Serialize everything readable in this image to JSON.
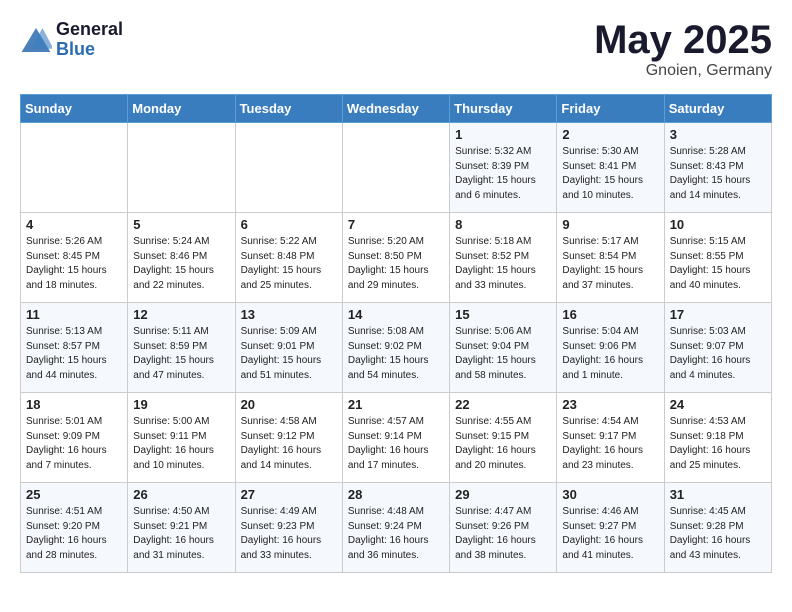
{
  "logo": {
    "general": "General",
    "blue": "Blue"
  },
  "title": "May 2025",
  "location": "Gnoien, Germany",
  "weekdays": [
    "Sunday",
    "Monday",
    "Tuesday",
    "Wednesday",
    "Thursday",
    "Friday",
    "Saturday"
  ],
  "weeks": [
    [
      {
        "num": "",
        "info": ""
      },
      {
        "num": "",
        "info": ""
      },
      {
        "num": "",
        "info": ""
      },
      {
        "num": "",
        "info": ""
      },
      {
        "num": "1",
        "info": "Sunrise: 5:32 AM\nSunset: 8:39 PM\nDaylight: 15 hours\nand 6 minutes."
      },
      {
        "num": "2",
        "info": "Sunrise: 5:30 AM\nSunset: 8:41 PM\nDaylight: 15 hours\nand 10 minutes."
      },
      {
        "num": "3",
        "info": "Sunrise: 5:28 AM\nSunset: 8:43 PM\nDaylight: 15 hours\nand 14 minutes."
      }
    ],
    [
      {
        "num": "4",
        "info": "Sunrise: 5:26 AM\nSunset: 8:45 PM\nDaylight: 15 hours\nand 18 minutes."
      },
      {
        "num": "5",
        "info": "Sunrise: 5:24 AM\nSunset: 8:46 PM\nDaylight: 15 hours\nand 22 minutes."
      },
      {
        "num": "6",
        "info": "Sunrise: 5:22 AM\nSunset: 8:48 PM\nDaylight: 15 hours\nand 25 minutes."
      },
      {
        "num": "7",
        "info": "Sunrise: 5:20 AM\nSunset: 8:50 PM\nDaylight: 15 hours\nand 29 minutes."
      },
      {
        "num": "8",
        "info": "Sunrise: 5:18 AM\nSunset: 8:52 PM\nDaylight: 15 hours\nand 33 minutes."
      },
      {
        "num": "9",
        "info": "Sunrise: 5:17 AM\nSunset: 8:54 PM\nDaylight: 15 hours\nand 37 minutes."
      },
      {
        "num": "10",
        "info": "Sunrise: 5:15 AM\nSunset: 8:55 PM\nDaylight: 15 hours\nand 40 minutes."
      }
    ],
    [
      {
        "num": "11",
        "info": "Sunrise: 5:13 AM\nSunset: 8:57 PM\nDaylight: 15 hours\nand 44 minutes."
      },
      {
        "num": "12",
        "info": "Sunrise: 5:11 AM\nSunset: 8:59 PM\nDaylight: 15 hours\nand 47 minutes."
      },
      {
        "num": "13",
        "info": "Sunrise: 5:09 AM\nSunset: 9:01 PM\nDaylight: 15 hours\nand 51 minutes."
      },
      {
        "num": "14",
        "info": "Sunrise: 5:08 AM\nSunset: 9:02 PM\nDaylight: 15 hours\nand 54 minutes."
      },
      {
        "num": "15",
        "info": "Sunrise: 5:06 AM\nSunset: 9:04 PM\nDaylight: 15 hours\nand 58 minutes."
      },
      {
        "num": "16",
        "info": "Sunrise: 5:04 AM\nSunset: 9:06 PM\nDaylight: 16 hours\nand 1 minute."
      },
      {
        "num": "17",
        "info": "Sunrise: 5:03 AM\nSunset: 9:07 PM\nDaylight: 16 hours\nand 4 minutes."
      }
    ],
    [
      {
        "num": "18",
        "info": "Sunrise: 5:01 AM\nSunset: 9:09 PM\nDaylight: 16 hours\nand 7 minutes."
      },
      {
        "num": "19",
        "info": "Sunrise: 5:00 AM\nSunset: 9:11 PM\nDaylight: 16 hours\nand 10 minutes."
      },
      {
        "num": "20",
        "info": "Sunrise: 4:58 AM\nSunset: 9:12 PM\nDaylight: 16 hours\nand 14 minutes."
      },
      {
        "num": "21",
        "info": "Sunrise: 4:57 AM\nSunset: 9:14 PM\nDaylight: 16 hours\nand 17 minutes."
      },
      {
        "num": "22",
        "info": "Sunrise: 4:55 AM\nSunset: 9:15 PM\nDaylight: 16 hours\nand 20 minutes."
      },
      {
        "num": "23",
        "info": "Sunrise: 4:54 AM\nSunset: 9:17 PM\nDaylight: 16 hours\nand 23 minutes."
      },
      {
        "num": "24",
        "info": "Sunrise: 4:53 AM\nSunset: 9:18 PM\nDaylight: 16 hours\nand 25 minutes."
      }
    ],
    [
      {
        "num": "25",
        "info": "Sunrise: 4:51 AM\nSunset: 9:20 PM\nDaylight: 16 hours\nand 28 minutes."
      },
      {
        "num": "26",
        "info": "Sunrise: 4:50 AM\nSunset: 9:21 PM\nDaylight: 16 hours\nand 31 minutes."
      },
      {
        "num": "27",
        "info": "Sunrise: 4:49 AM\nSunset: 9:23 PM\nDaylight: 16 hours\nand 33 minutes."
      },
      {
        "num": "28",
        "info": "Sunrise: 4:48 AM\nSunset: 9:24 PM\nDaylight: 16 hours\nand 36 minutes."
      },
      {
        "num": "29",
        "info": "Sunrise: 4:47 AM\nSunset: 9:26 PM\nDaylight: 16 hours\nand 38 minutes."
      },
      {
        "num": "30",
        "info": "Sunrise: 4:46 AM\nSunset: 9:27 PM\nDaylight: 16 hours\nand 41 minutes."
      },
      {
        "num": "31",
        "info": "Sunrise: 4:45 AM\nSunset: 9:28 PM\nDaylight: 16 hours\nand 43 minutes."
      }
    ]
  ]
}
